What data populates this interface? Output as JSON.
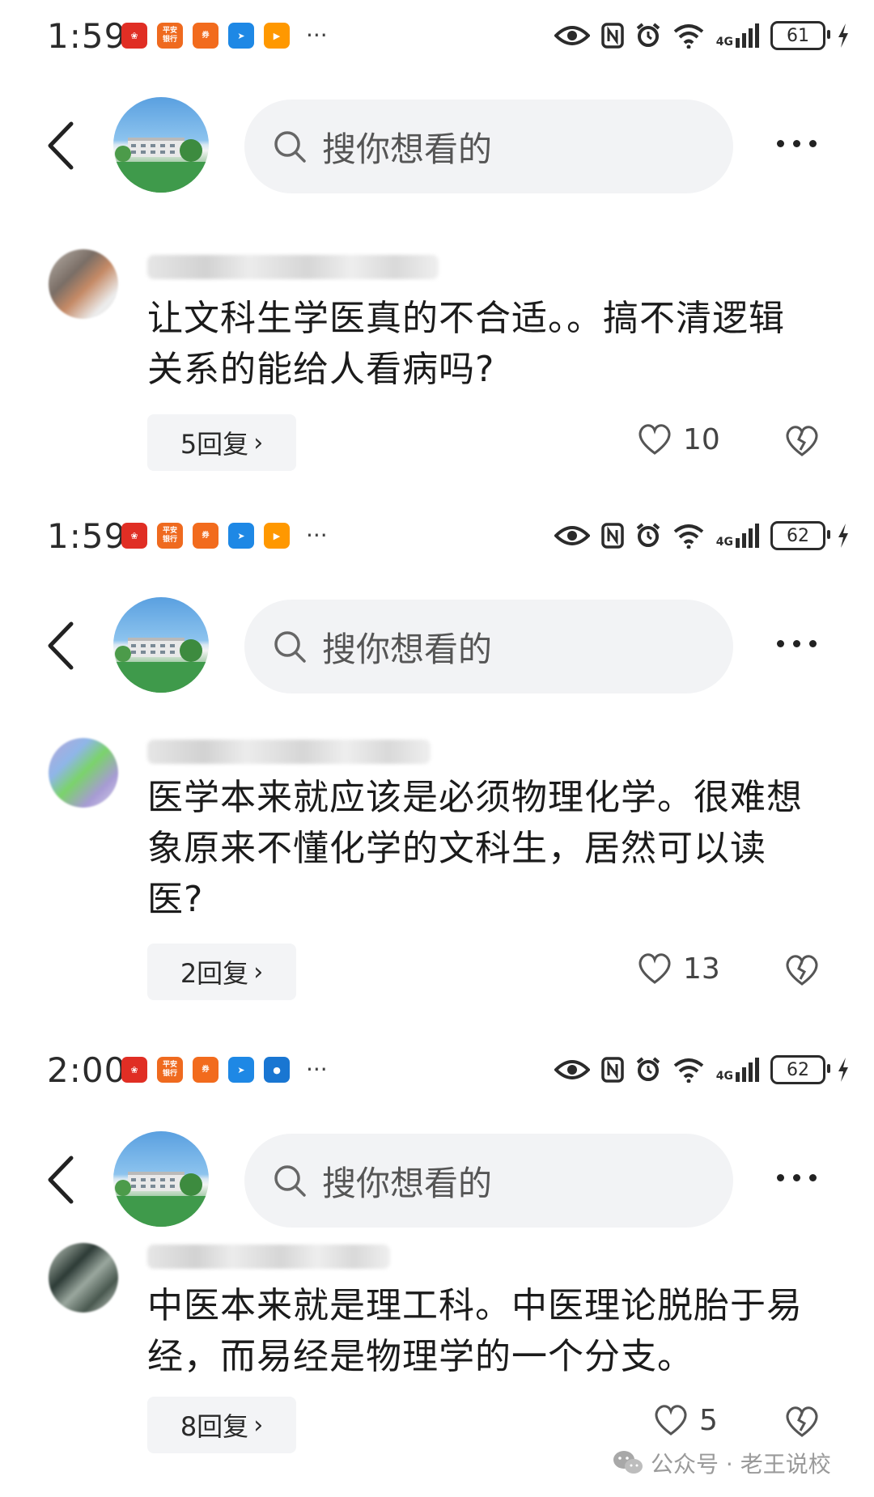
{
  "panels": [
    {
      "status": {
        "time": "1:59",
        "battery": "61"
      },
      "search_placeholder": "搜你想看的",
      "comment": {
        "text": "让文科生学医真的不合适。。搞不清逻辑关系的能给人看病吗?",
        "reply_label": "5回复",
        "likes": "10"
      }
    },
    {
      "status": {
        "time": "1:59",
        "battery": "62"
      },
      "search_placeholder": "搜你想看的",
      "comment": {
        "text": "医学本来就应该是必须物理化学。很难想象原来不懂化学的文科生，居然可以读医?",
        "reply_label": "2回复",
        "likes": "13"
      }
    },
    {
      "status": {
        "time": "2:00",
        "battery": "62"
      },
      "search_placeholder": "搜你想看的",
      "comment": {
        "text": "中医本来就是理工科。中医理论脱胎于易经，而易经是物理学的一个分支。",
        "reply_label": "8回复",
        "likes": "5"
      }
    }
  ],
  "status_icons": [
    "eye-icon",
    "nfc-icon",
    "alarm-icon",
    "wifi-icon",
    "4g-signal-icon",
    "battery-icon",
    "charging-icon"
  ],
  "app_icons": [
    "pinduoduo-icon",
    "pingan-bank-icon",
    "jiguang-icon",
    "feishu-icon",
    "video-icon",
    "more-notifications-icon"
  ],
  "app_icon_labels": {
    "pingan": "平安\n银行"
  },
  "signal_label": "4G",
  "watermark": "公众号 · 老王说校"
}
